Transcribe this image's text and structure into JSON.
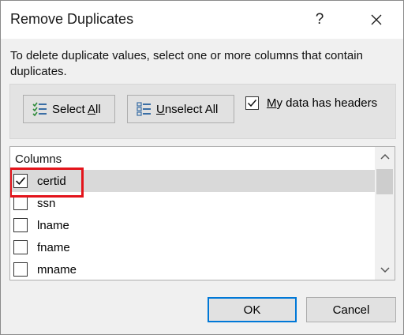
{
  "window": {
    "title": "Remove Duplicates",
    "help_label": "?"
  },
  "description": "To delete duplicate values, select one or more columns that contain duplicates.",
  "toolbar": {
    "select_all": {
      "mnemonic": "Select ",
      "underlined": "A",
      "rest": "ll"
    },
    "unselect_all": {
      "underlined": "U",
      "rest": "nselect All"
    },
    "has_headers": {
      "underlined": "M",
      "rest": "y data has headers",
      "checked": true
    }
  },
  "columns_list": {
    "header": "Columns",
    "items": [
      {
        "label": "certid",
        "checked": true,
        "selected": true
      },
      {
        "label": "ssn",
        "checked": false,
        "selected": false
      },
      {
        "label": "lname",
        "checked": false,
        "selected": false
      },
      {
        "label": "fname",
        "checked": false,
        "selected": false
      },
      {
        "label": "mname",
        "checked": false,
        "selected": false
      }
    ]
  },
  "buttons": {
    "ok": "OK",
    "cancel": "Cancel"
  },
  "colors": {
    "highlight": "#e3141b",
    "default_button_border": "#0078d7"
  }
}
